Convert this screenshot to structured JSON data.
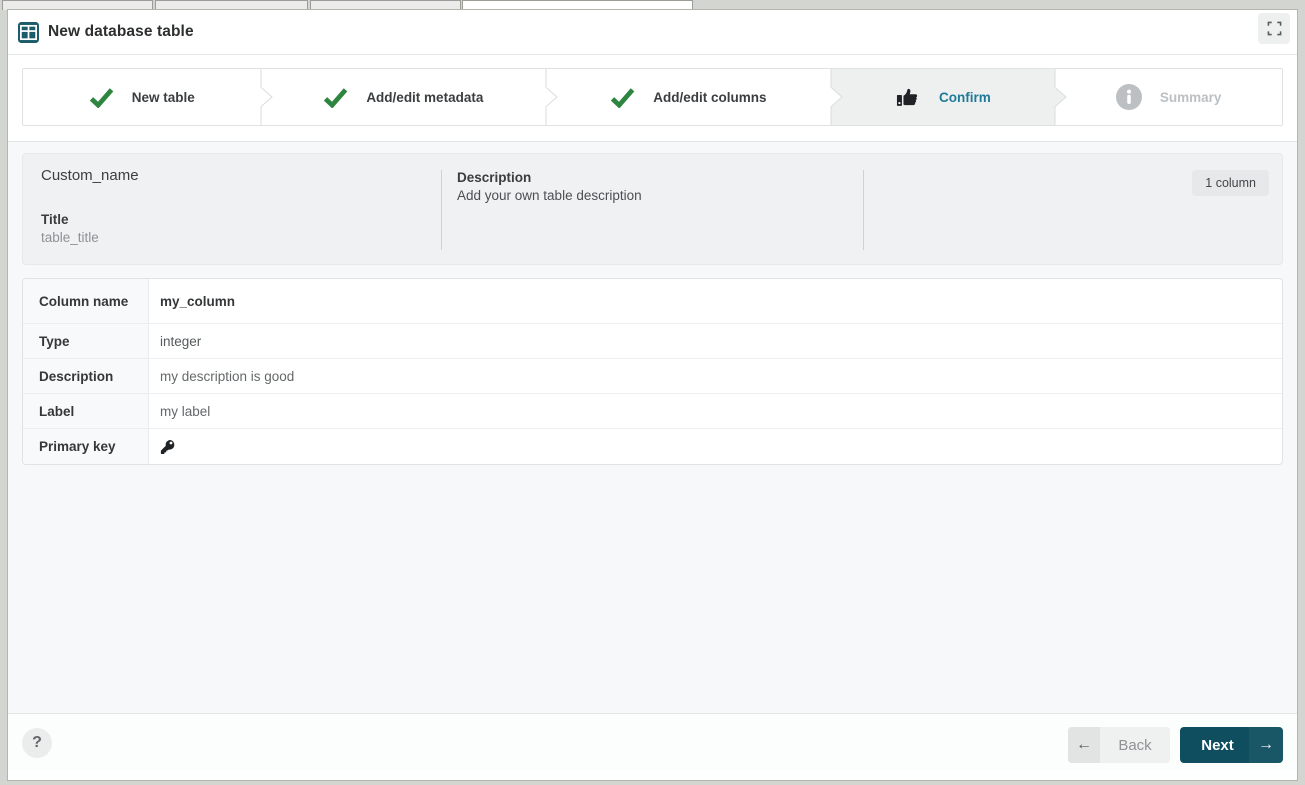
{
  "header": {
    "title": "New database table"
  },
  "steps": [
    {
      "label": "New table",
      "state": "done"
    },
    {
      "label": "Add/edit metadata",
      "state": "done"
    },
    {
      "label": "Add/edit columns",
      "state": "done"
    },
    {
      "label": "Confirm",
      "state": "active"
    },
    {
      "label": "Summary",
      "state": "upcoming"
    }
  ],
  "summary_card": {
    "custom_name": "Custom_name",
    "title_label": "Title",
    "title_value": "table_title",
    "description_label": "Description",
    "description_value": "Add your own table description",
    "columns_badge": "1 column"
  },
  "columns_table": {
    "rows": [
      {
        "label": "Column name",
        "value": "my_column"
      },
      {
        "label": "Type",
        "value": "integer"
      },
      {
        "label": "Description",
        "value": "my description is good"
      },
      {
        "label": "Label",
        "value": "my label"
      },
      {
        "label": "Primary key",
        "value": "",
        "icon": "key-icon"
      }
    ]
  },
  "footer": {
    "help_label": "?",
    "back_arrow": "←",
    "back_label": "Back",
    "next_label": "Next",
    "next_arrow": "→"
  },
  "colors": {
    "brand_teal": "#0e4e5e",
    "step_done_green": "#2e8540",
    "step_active_text": "#1f7a99",
    "active_step_bg": "#eef0f0",
    "card_bg": "#eff1f2",
    "page_bg": "#f7f8f9"
  }
}
